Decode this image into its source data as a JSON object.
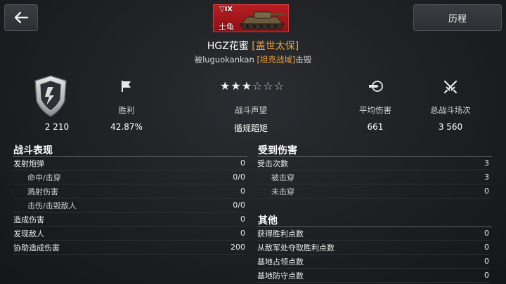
{
  "header": {
    "history_label": "历程",
    "vehicle": {
      "tier": "IX",
      "name": "土龟"
    }
  },
  "player": {
    "name": "HGZ花蜜",
    "clan": "[盖世太保]"
  },
  "killed_by": {
    "prefix": "被",
    "killer": "luguokankan",
    "clan": "[坦克战域]",
    "suffix": "击毁"
  },
  "summary": {
    "rank_value": "2 210",
    "win_label": "胜利",
    "win_value": "42.87%",
    "reputation_label": "战斗声望",
    "reputation_value": "循规蹈矩",
    "reputation_stars": 3,
    "reputation_stars_max": 6,
    "avg_damage_label": "平均伤害",
    "avg_damage_value": "661",
    "battles_label": "总战斗场次",
    "battles_value": "3 560"
  },
  "combat": {
    "title": "战斗表现",
    "rows": [
      {
        "label": "发射炮弹",
        "value": "0",
        "sub": false
      },
      {
        "label": "命中/击穿",
        "value": "0/0",
        "sub": true
      },
      {
        "label": "溅射伤害",
        "value": "0",
        "sub": true
      },
      {
        "label": "击伤/击毁敌人",
        "value": "0/0",
        "sub": true
      },
      {
        "label": "造成伤害",
        "value": "0",
        "sub": false
      },
      {
        "label": "发现敌人",
        "value": "0",
        "sub": false
      },
      {
        "label": "协助造成伤害",
        "value": "200",
        "sub": false
      }
    ]
  },
  "received": {
    "title": "受到伤害",
    "rows": [
      {
        "label": "受击次数",
        "value": "3",
        "sub": false
      },
      {
        "label": "被击穿",
        "value": "3",
        "sub": true
      },
      {
        "label": "未击穿",
        "value": "0",
        "sub": true
      }
    ]
  },
  "other": {
    "title": "其他",
    "rows": [
      {
        "label": "获得胜利点数",
        "value": "0"
      },
      {
        "label": "从敌军处夺取胜利点数",
        "value": "0"
      },
      {
        "label": "基地占领点数",
        "value": "0"
      },
      {
        "label": "基地防守点数",
        "value": "0"
      }
    ]
  },
  "colors": {
    "clan": "#f2a23a",
    "badge": "#b81e22"
  }
}
